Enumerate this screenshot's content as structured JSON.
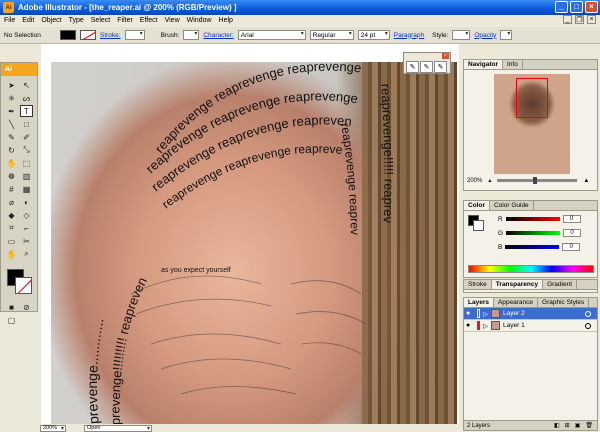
{
  "window": {
    "title": "Adobe Illustrator - [the_reaper.ai @ 200% (RGB/Preview) ]",
    "app_badge": "Ai"
  },
  "menu": [
    "File",
    "Edit",
    "Object",
    "Type",
    "Select",
    "Filter",
    "Effect",
    "View",
    "Window",
    "Help"
  ],
  "control": {
    "selection": "No Selection",
    "stroke_label": "Stroke:",
    "brush_label": "Brush:",
    "character_label": "Character:",
    "font": "Arial",
    "style": "Regular",
    "size": "24 pt",
    "paragraph_label": "Paragraph",
    "style_label": "Style:",
    "opacity_label": "Opacity"
  },
  "artwork": {
    "word": "reaprevenge",
    "lines": [
      "reaprevenge reaprevenge reaprevenge",
      "reaprevenge reaprevenge reaprevenge rea",
      "reaprevenge reaprevenge reaprevenge",
      "reaprevenge reaprevenge reapreven",
      "reaprevenge............",
      "reaprevenge!!!!!!!!! reapreven",
      "reaprevenge!!!!! reaprev",
      "reaprevenge reaprev",
      "as you expect yourself"
    ]
  },
  "status": {
    "zoom": "200%",
    "state": "Open"
  },
  "navigator": {
    "tabs": [
      "Navigator",
      "Info"
    ],
    "zoom": "200%"
  },
  "color": {
    "tabs": [
      "Color",
      "Color Guide"
    ],
    "channels": [
      {
        "label": "R",
        "value": "0",
        "color": "#cc0000"
      },
      {
        "label": "G",
        "value": "0",
        "color": "#00aa00"
      },
      {
        "label": "B",
        "value": "0",
        "color": "#0000cc"
      }
    ]
  },
  "transparency": {
    "tabs": [
      "Stroke",
      "Transparency",
      "Gradient"
    ]
  },
  "layers": {
    "tabs": [
      "Layers",
      "Appearance",
      "Graphic Styles"
    ],
    "items": [
      {
        "name": "Layer 2",
        "color": "#3b6ccf"
      },
      {
        "name": "Layer 1",
        "color": "#cc2222"
      }
    ],
    "count": "2 Layers"
  }
}
